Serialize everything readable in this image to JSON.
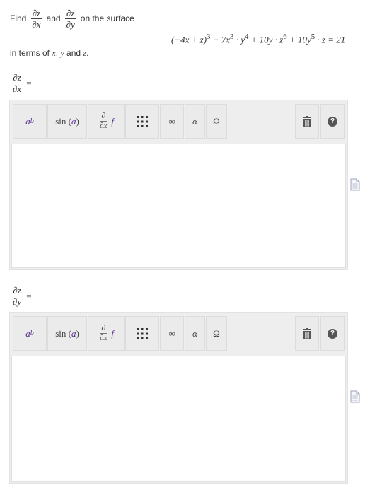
{
  "prompt": {
    "find": "Find",
    "dz": "∂z",
    "dx": "∂x",
    "dy": "∂y",
    "and": "and",
    "on_surface": "on the surface",
    "in_terms_prefix": "in terms of",
    "var_x": "x",
    "comma": ",",
    "var_y": "y",
    "and_word": "and",
    "var_z": "z",
    "period": "."
  },
  "surface_equation": {
    "base": "(−4x + z)",
    "base_exp": "3",
    "t2_pre": " − 7x",
    "t2_exp": "3",
    "t2_mid": " · y",
    "t2_exp2": "4",
    "t3_pre": " + 10y · z",
    "t3_exp": "6",
    "t4_pre": " + 10y",
    "t4_exp": "5",
    "t4_post": " · z = 21"
  },
  "answers": [
    {
      "numerator": "∂z",
      "denominator": "∂x",
      "equals": "="
    },
    {
      "numerator": "∂z",
      "denominator": "∂y",
      "equals": "="
    }
  ],
  "toolbar": {
    "power_base": "a",
    "power_exp": "b",
    "sin_fn": "sin",
    "sin_open": "(",
    "sin_arg": "a",
    "sin_close": ")",
    "partial_num": "∂",
    "partial_den": "∂x",
    "partial_f": "f",
    "infinity": "∞",
    "alpha": "α",
    "omega": "Ω",
    "help": "?"
  },
  "icons": {
    "matrix": "matrix-icon",
    "trash": "trash-icon",
    "help": "help-icon",
    "document": "document-icon"
  },
  "colors": {
    "toolbar_bg": "#eeeeee",
    "button_bg": "#ebebeb",
    "purple": "#5a2d91",
    "icon_dark": "#555555"
  }
}
